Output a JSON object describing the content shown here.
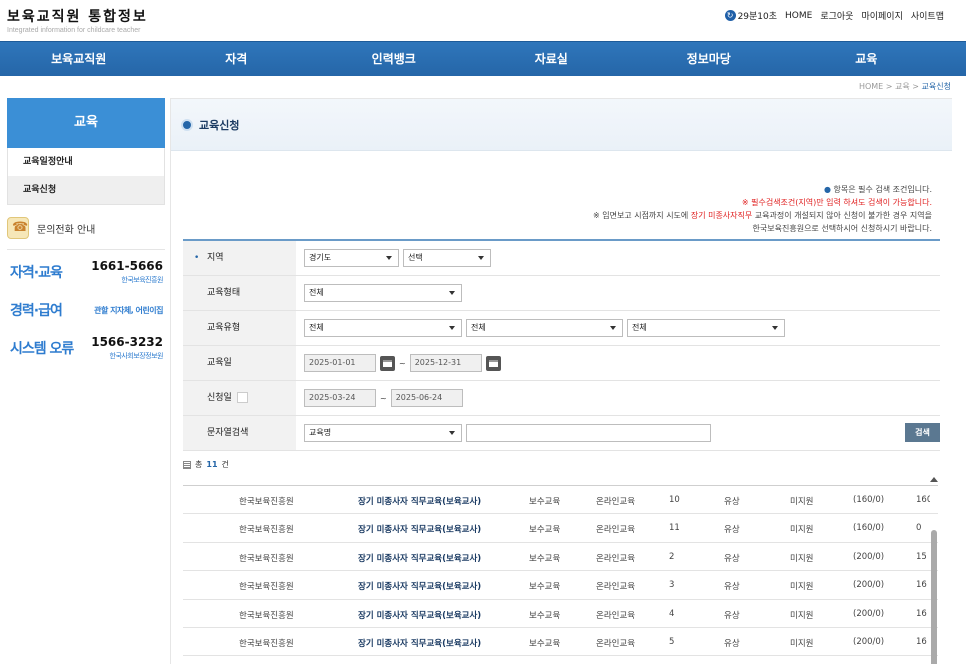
{
  "header": {
    "logo_title": "보육교직원 통합정보",
    "logo_sub": "Integrated information for childcare teacher",
    "timer": "29분10초",
    "util_links": [
      "HOME",
      "로그아웃",
      "마이페이지",
      "사이트맵"
    ]
  },
  "gnb": [
    "보육교직원",
    "자격",
    "인력뱅크",
    "자료실",
    "정보마당",
    "교육"
  ],
  "breadcrumb": {
    "home": "HOME",
    "sep": ">",
    "level1": "교육",
    "current": "교육신청"
  },
  "sidebar": {
    "title": "교육",
    "items": [
      "교육일정안내",
      "교육신청"
    ],
    "contact_title": "문의전화 안내",
    "contacts": [
      {
        "label": "자격·교육",
        "number": "1661-5666",
        "org": "한국보육진흥원"
      },
      {
        "label": "경력·급여",
        "note": "관할 지자체, 어린이집"
      },
      {
        "label": "시스템 오류",
        "number": "1566-3232",
        "org": "한국사회보장정보원"
      }
    ]
  },
  "page": {
    "title": "교육신청",
    "notes": {
      "line1": "항목은 필수 검색 조건입니다.",
      "line2": "※ 필수검색조건(지역)만 입력 하셔도 검색이 가능합니다.",
      "line3_a": "※ 임면보고 시점까지 시도에 ",
      "line3_hl": "장기 미종사자직무",
      "line3_b": " 교육과정이 개설되지 않아 신청이 불가한 경우 지역을",
      "line4": "한국보육진흥원으로 선택하시어 신청하시기 바랍니다."
    }
  },
  "form": {
    "region_label": "지역",
    "region_value": "경기도",
    "region_sub_value": "선택",
    "edu_form_label": "교육형태",
    "edu_form_value": "전체",
    "edu_type_label": "교육유형",
    "edu_type_values": [
      "전체",
      "전체",
      "전체"
    ],
    "edu_date_label": "교육일",
    "edu_date_from": "2025-01-01",
    "edu_date_to": "2025-12-31",
    "apply_date_label": "신청일",
    "apply_date_from": "2025-03-24",
    "apply_date_to": "2025-06-24",
    "text_search_label": "문자열검색",
    "text_search_field": "교육명",
    "text_search_value": "",
    "tilde": "~",
    "search_button": "검색"
  },
  "result": {
    "prefix": "총",
    "count": "11",
    "suffix": "건"
  },
  "rows": [
    {
      "inst": "한국보육진흥원",
      "name": "장기 미종사자 직무교육(보육교사)",
      "cat": "보수교육",
      "type": "온라인교육",
      "no": "10",
      "fee": "유상",
      "support": "미지원",
      "cap": "(160/0)",
      "rem": "160"
    },
    {
      "inst": "한국보육진흥원",
      "name": "장기 미종사자 직무교육(보육교사)",
      "cat": "보수교육",
      "type": "온라인교육",
      "no": "11",
      "fee": "유상",
      "support": "미지원",
      "cap": "(160/0)",
      "rem": "0"
    },
    {
      "inst": "한국보육진흥원",
      "name": "장기 미종사자 직무교육(보육교사)",
      "cat": "보수교육",
      "type": "온라인교육",
      "no": "2",
      "fee": "유상",
      "support": "미지원",
      "cap": "(200/0)",
      "rem": "15"
    },
    {
      "inst": "한국보육진흥원",
      "name": "장기 미종사자 직무교육(보육교사)",
      "cat": "보수교육",
      "type": "온라인교육",
      "no": "3",
      "fee": "유상",
      "support": "미지원",
      "cap": "(200/0)",
      "rem": "16"
    },
    {
      "inst": "한국보육진흥원",
      "name": "장기 미종사자 직무교육(보육교사)",
      "cat": "보수교육",
      "type": "온라인교육",
      "no": "4",
      "fee": "유상",
      "support": "미지원",
      "cap": "(200/0)",
      "rem": "16"
    },
    {
      "inst": "한국보육진흥원",
      "name": "장기 미종사자 직무교육(보육교사)",
      "cat": "보수교육",
      "type": "온라인교육",
      "no": "5",
      "fee": "유상",
      "support": "미지원",
      "cap": "(200/0)",
      "rem": "16"
    }
  ],
  "colors": {
    "primary": "#2566a8",
    "accent": "#3b8fd6",
    "required": "#e02020"
  }
}
